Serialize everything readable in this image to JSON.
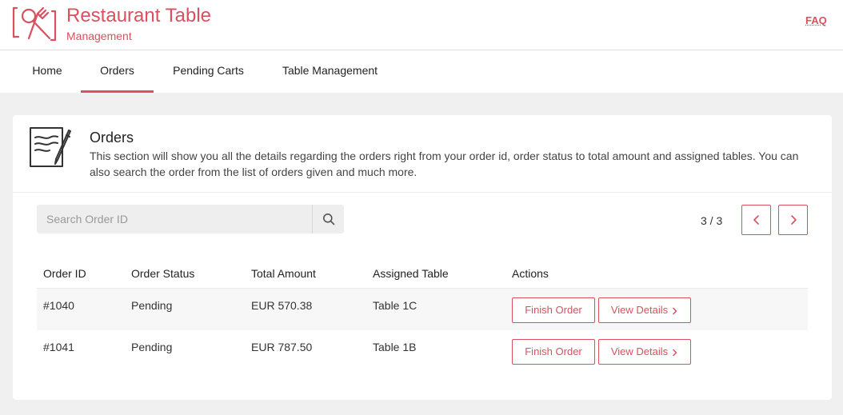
{
  "brand": {
    "title": "Restaurant Table",
    "subtitle": "Management",
    "color": "#d9505f"
  },
  "header": {
    "faq_label": "FAQ"
  },
  "nav": {
    "items": [
      {
        "label": "Home"
      },
      {
        "label": "Orders"
      },
      {
        "label": "Pending Carts"
      },
      {
        "label": "Table Management"
      }
    ],
    "active": "Orders"
  },
  "orders": {
    "title": "Orders",
    "description": "This section will show you all the details regarding the orders right from your order id, order status to total amount and assigned tables. You can also search the order from the list of orders given and much more.",
    "search": {
      "placeholder": "Search Order ID",
      "value": ""
    },
    "pagination": {
      "label": "3 / 3"
    },
    "columns": [
      "Order ID",
      "Order Status",
      "Total Amount",
      "Assigned Table",
      "Actions"
    ],
    "rows": [
      {
        "id": "#1040",
        "status": "Pending",
        "amount": "EUR 570.38",
        "table": "Table 1C"
      },
      {
        "id": "#1041",
        "status": "Pending",
        "amount": "EUR 787.50",
        "table": "Table 1B"
      }
    ],
    "actions": {
      "finish_label": "Finish Order",
      "details_label": "View Details"
    }
  },
  "icons": {
    "logo": "restaurant-logo-icon",
    "orders": "orders-clipboard-icon",
    "search": "search-icon",
    "prev": "chevron-left-icon",
    "next": "chevron-right-icon"
  }
}
